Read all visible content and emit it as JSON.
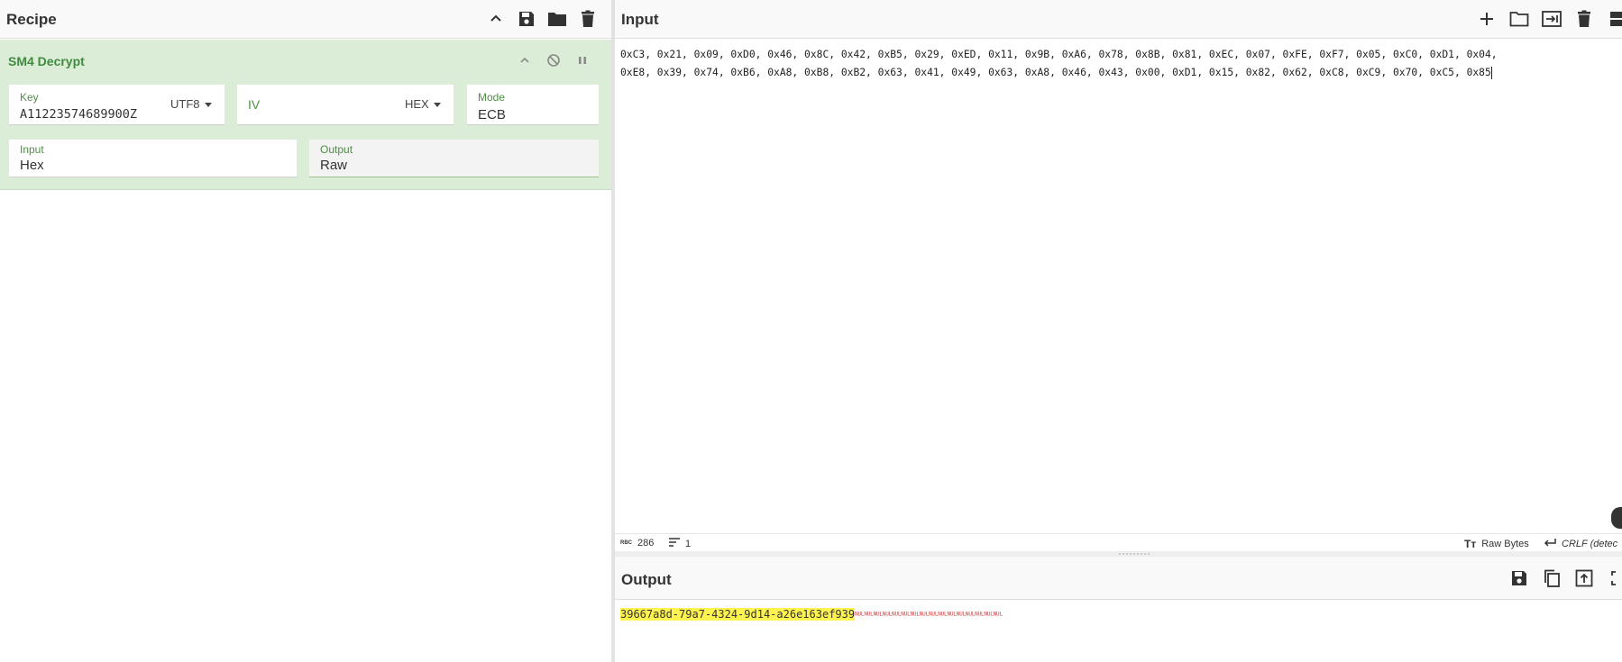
{
  "recipe": {
    "title": "Recipe",
    "icons": [
      "chevron-up-icon",
      "save-icon",
      "folder-icon",
      "trash-icon"
    ],
    "operation": {
      "name": "SM4 Decrypt",
      "key": {
        "label": "Key",
        "value": "A11223574689900Z",
        "encoding": "UTF8"
      },
      "iv": {
        "label": "IV",
        "value": "",
        "encoding": "HEX"
      },
      "mode": {
        "label": "Mode",
        "value": "ECB"
      },
      "input": {
        "label": "Input",
        "value": "Hex"
      },
      "output": {
        "label": "Output",
        "value": "Raw"
      }
    }
  },
  "input": {
    "title": "Input",
    "line1": "0xC3, 0x21, 0x09, 0xD0, 0x46, 0x8C, 0x42, 0xB5, 0x29, 0xED, 0x11, 0x9B, 0xA6, 0x78, 0x8B, 0x81, 0xEC, 0x07, 0xFE, 0xF7, 0x05, 0xC0, 0xD1, 0x04,",
    "line2": "0xE8, 0x39, 0x74, 0xB6, 0xA8, 0xB8, 0xB2, 0x63, 0x41, 0x49, 0x63, 0xA8, 0x46, 0x43, 0x00, 0xD1, 0x15, 0x82, 0x62, 0xC8, 0xC9, 0x70, 0xC5, 0x85",
    "status": {
      "chars_icon_label": "RBC",
      "chars": "286",
      "lines": "1",
      "format": "Raw Bytes",
      "eol": "CRLF (detec"
    }
  },
  "output": {
    "title": "Output",
    "highlighted": "39667a8d-79a7-4324-9d14-a26e163ef939",
    "nul_text": "NULNULNULNULNULNULNULNULNULNULNULNULNULNULNULNUL"
  },
  "colors": {
    "accent_green": "#3e8b3f",
    "operation_bg": "#dcedd7",
    "highlight": "#fff44f",
    "nul_red": "#d73a3a"
  }
}
